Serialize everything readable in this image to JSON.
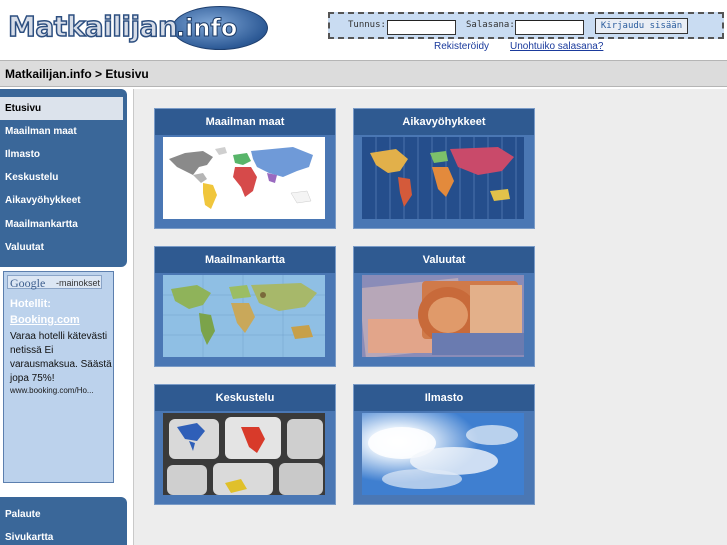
{
  "header": {
    "logo_text": "Matkailijan",
    "logo_suffix": ".info",
    "login": {
      "username_label": "Tunnus:",
      "password_label": "Salasana:",
      "login_button": "Kirjaudu sisään"
    },
    "register_link": "Rekisteröidy",
    "forgot_link": "Unohtuiko salasana?"
  },
  "breadcrumb": "Matkailijan.info > Etusivu",
  "sidebar": {
    "items": [
      {
        "label": "Etusivu",
        "active": true
      },
      {
        "label": "Maailman maat"
      },
      {
        "label": "Ilmasto"
      },
      {
        "label": "Keskustelu"
      },
      {
        "label": "Aikavyöhykkeet"
      },
      {
        "label": "Maailmankartta"
      },
      {
        "label": "Valuutat"
      }
    ],
    "bottom_items": [
      {
        "label": "Palaute"
      },
      {
        "label": "Sivukartta"
      }
    ]
  },
  "ad": {
    "google": "Google",
    "mainokset": "-mainokset",
    "title": "Hotellit:",
    "link": "Booking.com",
    "body": "Varaa hotelli kätevästi netissä Ei varausmaksua. Säästä jopa 75%!",
    "url": "www.booking.com/Ho..."
  },
  "tiles": [
    {
      "title": "Maailman maat",
      "image": "world-map-colored"
    },
    {
      "title": "Aikavyöhykkeet",
      "image": "time-zones-map"
    },
    {
      "title": "Maailmankartta",
      "image": "world-map-relief"
    },
    {
      "title": "Valuutat",
      "image": "euro-banknotes"
    },
    {
      "title": "Keskustelu",
      "image": "keyboard-continents"
    },
    {
      "title": "Ilmasto",
      "image": "sky-clouds-sun"
    }
  ],
  "colors": {
    "sidebar_blue": "#3a6799",
    "tile_blue": "#4a77b4",
    "tile_title_blue": "#2f5a91",
    "link_blue": "#1a3a9c"
  }
}
